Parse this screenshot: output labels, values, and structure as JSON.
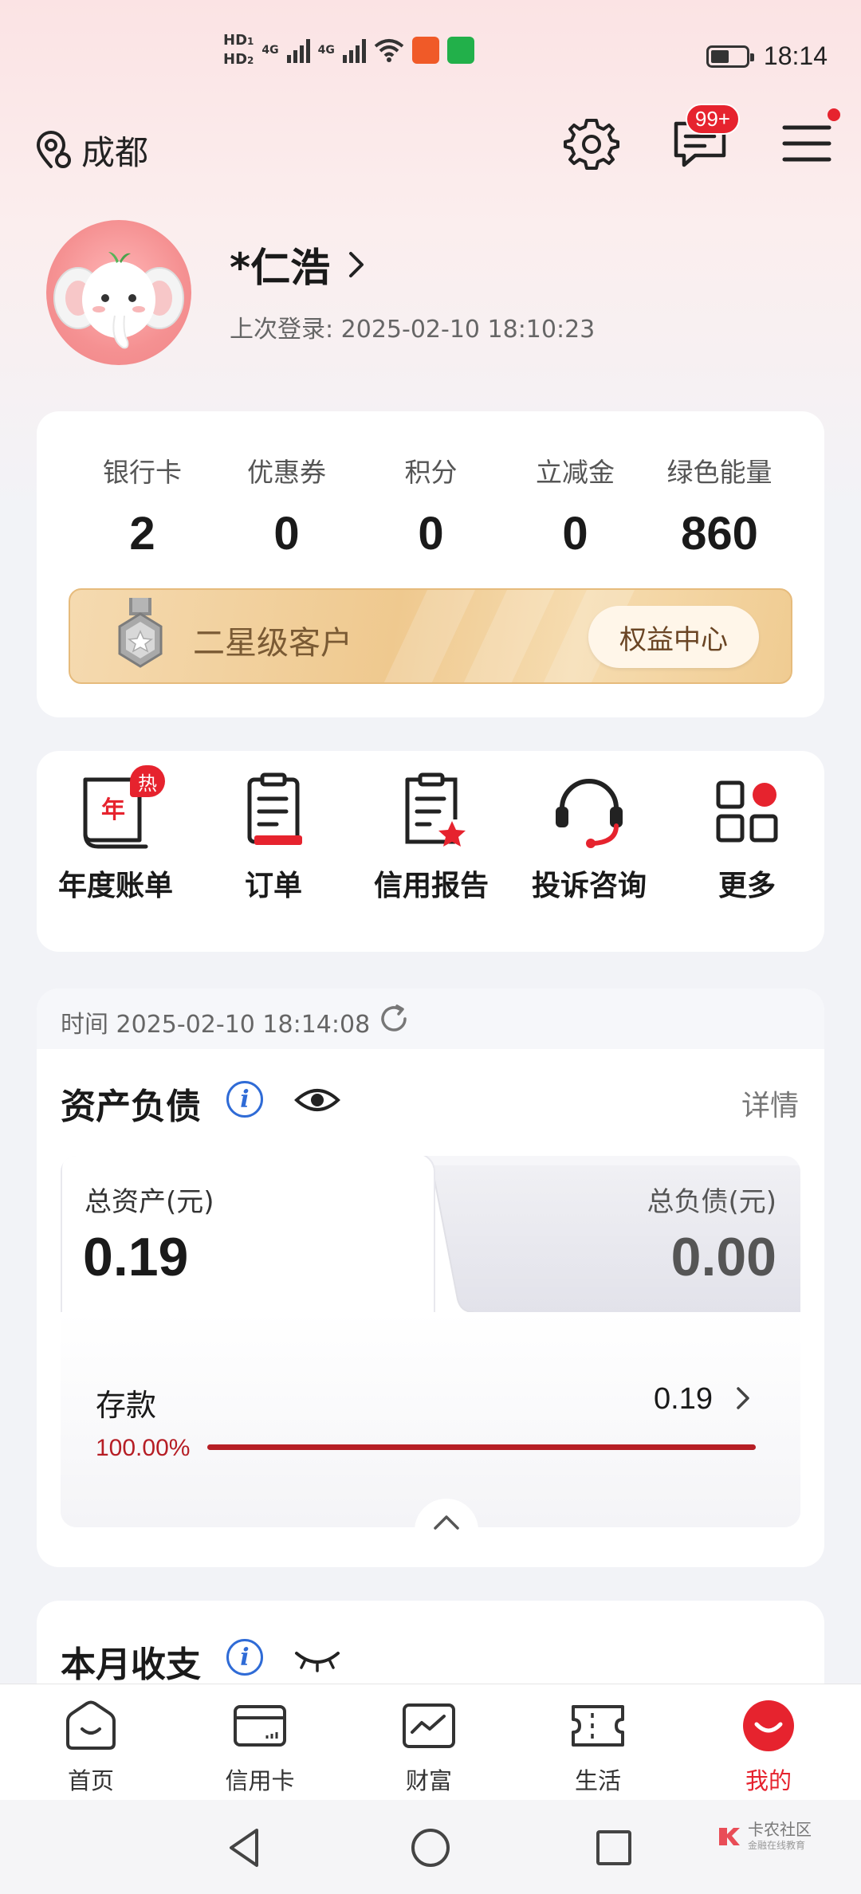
{
  "status_bar": {
    "time": "18:14",
    "sim1": "HD",
    "sim1_num": "1",
    "sim2": "HD",
    "sim2_num": "2",
    "net1": "4G",
    "net2": "4G"
  },
  "header": {
    "city": "成都",
    "message_badge": "99+"
  },
  "profile": {
    "name": "*仁浩",
    "last_login": "上次登录: 2025-02-10 18:10:23"
  },
  "stats": [
    {
      "label": "银行卡",
      "value": "2"
    },
    {
      "label": "优惠券",
      "value": "0"
    },
    {
      "label": "积分",
      "value": "0"
    },
    {
      "label": "立减金",
      "value": "0"
    },
    {
      "label": "绿色能量",
      "value": "860"
    }
  ],
  "level": {
    "label": "二星级客户",
    "button": "权益中心"
  },
  "quick_actions": [
    {
      "label": "年度账单",
      "icon": "annual-bill-icon",
      "hot": "热",
      "hot_char": "年"
    },
    {
      "label": "订单",
      "icon": "order-icon"
    },
    {
      "label": "信用报告",
      "icon": "credit-report-icon"
    },
    {
      "label": "投诉咨询",
      "icon": "customer-service-icon"
    },
    {
      "label": "更多",
      "icon": "more-grid-icon"
    }
  ],
  "assets": {
    "time": "时间 2025-02-10 18:14:08",
    "title": "资产负债",
    "detail": "详情",
    "total_assets_label": "总资产(元)",
    "total_assets": "0.19",
    "total_liabilities_label": "总负债(元)",
    "total_liabilities": "0.00",
    "deposit_label": "存款",
    "deposit_value": "0.19",
    "deposit_pct": "100.00%",
    "deposit_fraction": 1.0
  },
  "income": {
    "title": "本月收支"
  },
  "tabbar": [
    {
      "label": "首页",
      "icon": "home-icon"
    },
    {
      "label": "信用卡",
      "icon": "credit-card-icon"
    },
    {
      "label": "财富",
      "icon": "wealth-chart-icon"
    },
    {
      "label": "生活",
      "icon": "life-ticket-icon"
    },
    {
      "label": "我的",
      "icon": "me-icon",
      "active": true
    }
  ],
  "watermark": {
    "title": "卡农社区",
    "subtitle": "金融在线教育"
  },
  "colors": {
    "accent_red": "#e6232e",
    "deposit_red": "#b61e25",
    "info_blue": "#2f6bd6",
    "gold": "#efc98f"
  }
}
